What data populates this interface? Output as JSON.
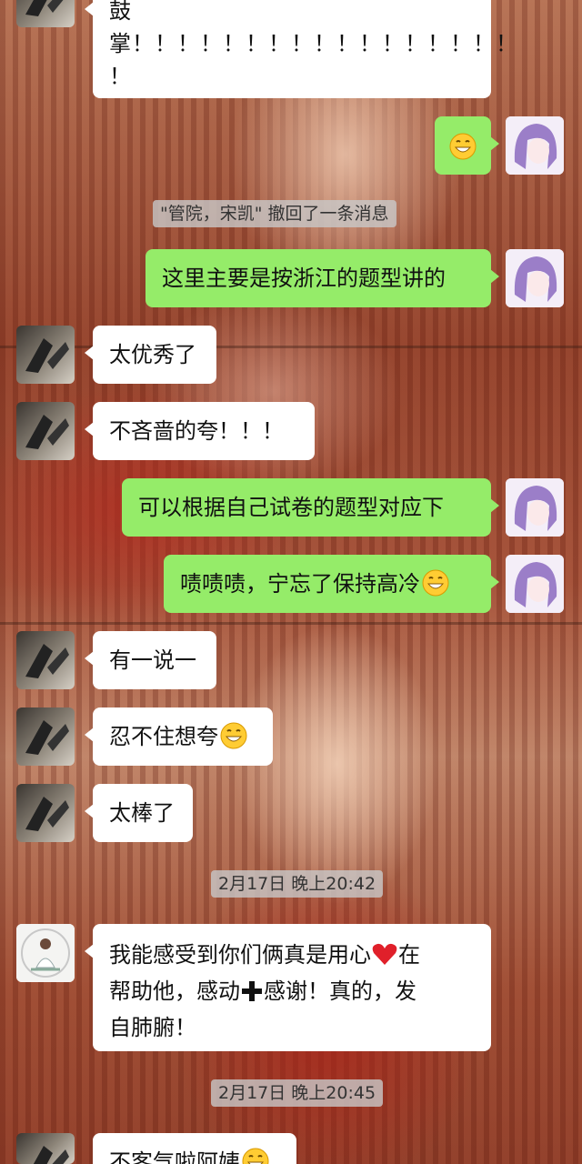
{
  "chat": {
    "messages": [
      {
        "side": "left",
        "sender": "friend",
        "text": "鼓掌！！！！！！！！！！！！！！！！！！"
      },
      {
        "side": "right",
        "sender": "me",
        "text": "",
        "emoji": "grinning-face-icon"
      },
      {
        "system": true,
        "text": "\"管院，宋凯\" 撤回了一条消息"
      },
      {
        "side": "right",
        "sender": "me",
        "text": "这里主要是按浙江的题型讲的"
      },
      {
        "side": "left",
        "sender": "friend",
        "text": "太优秀了"
      },
      {
        "side": "left",
        "sender": "friend",
        "text": "不吝啬的夸！！！"
      },
      {
        "side": "right",
        "sender": "me",
        "text": "可以根据自己试卷的题型对应下"
      },
      {
        "side": "right",
        "sender": "me",
        "text": "啧啧啧，宁忘了保持高冷",
        "emoji": "grinning-face-icon"
      },
      {
        "side": "left",
        "sender": "friend",
        "text": "有一说一"
      },
      {
        "side": "left",
        "sender": "friend",
        "text": "忍不住想夸",
        "emoji": "grinning-face-icon"
      },
      {
        "side": "left",
        "sender": "friend",
        "text": "太棒了"
      },
      {
        "timestamp": "2月17日 晚上20:42"
      },
      {
        "side": "left",
        "sender": "aunt",
        "text_parts": [
          "我能感受到你们俩真是用心",
          "在帮助他，感动",
          "感谢！真的，发自肺腑！"
        ],
        "emojis": [
          "red-heart-icon",
          "plus-icon"
        ]
      },
      {
        "timestamp": "2月17日 晚上20:45"
      },
      {
        "side": "left",
        "sender": "friend",
        "text": "不客气啦阿姨",
        "emoji": "grinning-face-icon"
      }
    ]
  },
  "top_partial": {
    "line1": "鼓",
    "line2": "掌！！！！！！！！！！！！！！！！！",
    "line3": "！"
  },
  "system_notice": "\"管院，宋凯\" 撤回了一条消息",
  "msg_zhejiang": "这里主要是按浙江的题型讲的",
  "msg_youxiu": "太优秀了",
  "msg_bulinse": "不吝啬的夸！！！",
  "msg_duiying": "可以根据自己试卷的题型对应下",
  "msg_zeze": "啧啧啧，宁忘了保持高冷",
  "msg_youyi": "有一说一",
  "msg_renbuzhu": "忍不住想夸",
  "msg_taibang": "太棒了",
  "time_1": "2月17日 晚上20:42",
  "aunt_msg": {
    "part1": "我能感受到你们俩真是用心",
    "part2": "在",
    "part3": "帮助他，感动",
    "part4": "感谢！真的，发",
    "part5": "自肺腑！"
  },
  "time_2": "2月17日 晚上20:45",
  "msg_bukeqi": "不客气啦阿姨",
  "colors": {
    "green_bubble": "#95ec69",
    "white_bubble": "#ffffff",
    "system_bg": "#c8c8c8"
  }
}
